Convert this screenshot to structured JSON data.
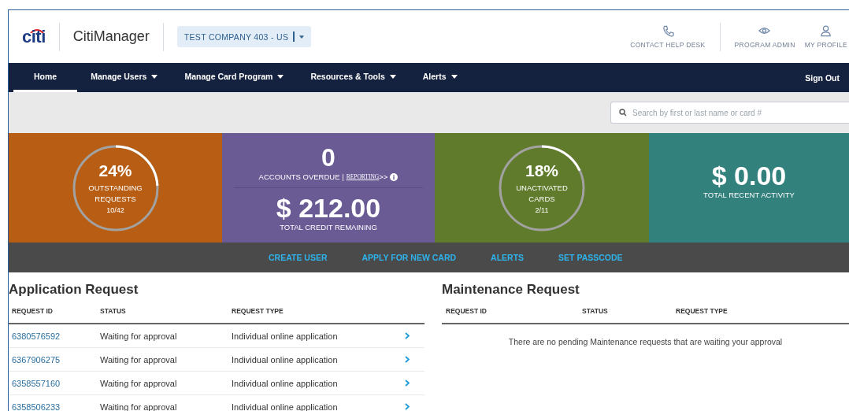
{
  "header": {
    "logo": "citi",
    "app_name": "CitiManager",
    "company": "TEST COMPANY 403 - US",
    "utility_links": [
      {
        "label": "CONTACT HELP DESK",
        "kind": "phone"
      },
      {
        "label": "PROGRAM ADMIN",
        "kind": "eye"
      },
      {
        "label": "MY PROFILE",
        "kind": "person"
      }
    ]
  },
  "nav": {
    "items": [
      {
        "label": "Home",
        "dropdown": false,
        "selected": true
      },
      {
        "label": "Manage Users",
        "dropdown": true,
        "selected": false
      },
      {
        "label": "Manage Card Program",
        "dropdown": true,
        "selected": false
      },
      {
        "label": "Resources & Tools",
        "dropdown": true,
        "selected": false
      },
      {
        "label": "Alerts",
        "dropdown": true,
        "selected": false
      }
    ],
    "sign_out": "Sign Out"
  },
  "search": {
    "placeholder": "Search by first or last name or card #"
  },
  "tiles": [
    {
      "kind": "ring",
      "color": "#b85e14",
      "value": "24%",
      "label": "OUTSTANDING REQUESTS",
      "count": "10/42",
      "level": 0.24
    },
    {
      "kind": "credit",
      "color": "#6a5b95",
      "overdue": "0",
      "overdue_label": "ACCOUNTS OVERDUE |",
      "link": "REPORTING",
      "link_suffix": ">>",
      "amount": "$ 212.00",
      "amount_label": "TOTAL CREDIT REMAINING"
    },
    {
      "kind": "ring",
      "color": "#5f7b2b",
      "value": "18%",
      "label": "UNACTIVATED CARDS",
      "count": "2/11",
      "level": 0.18
    },
    {
      "kind": "amount",
      "color": "#33817c",
      "amount": "$ 0.00",
      "amount_label": "TOTAL RECENT ACTIVITY"
    }
  ],
  "actions": [
    "CREATE USER",
    "APPLY FOR NEW CARD",
    "ALERTS",
    "SET PASSCODE"
  ],
  "application_request": {
    "title": "Application Request",
    "columns": [
      "REQUEST ID",
      "STATUS",
      "REQUEST TYPE"
    ],
    "rows": [
      {
        "id": "6380576592",
        "status": "Waiting for approval",
        "type": "Individual online application"
      },
      {
        "id": "6367906275",
        "status": "Waiting for approval",
        "type": "Individual online application"
      },
      {
        "id": "6358557160",
        "status": "Waiting for approval",
        "type": "Individual online application"
      },
      {
        "id": "6358506233",
        "status": "Waiting for approval",
        "type": "Individual online application"
      }
    ]
  },
  "maintenance_request": {
    "title": "Maintenance Request",
    "columns": [
      "REQUEST ID",
      "STATUS",
      "REQUEST TYPE"
    ],
    "empty_message": "There are no pending Maintenance requests that are waiting your approval"
  }
}
